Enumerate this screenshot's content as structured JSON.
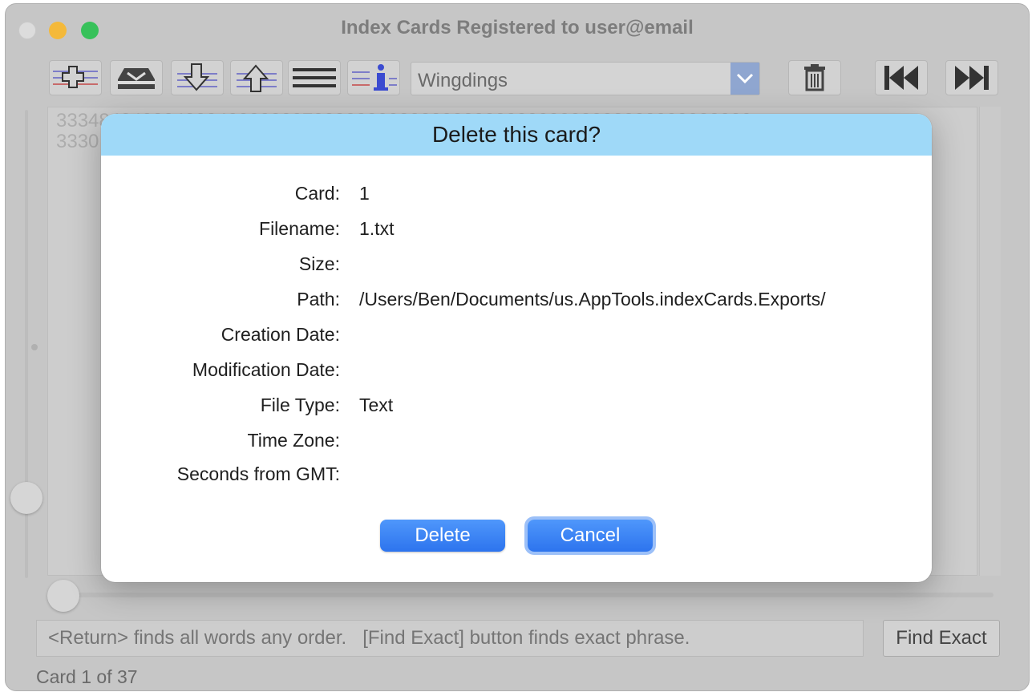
{
  "window": {
    "title": "Index Cards Registered to user@email"
  },
  "toolbar": {
    "buttons": [
      {
        "icon": "add-card-icon"
      },
      {
        "icon": "inbox-tray-icon"
      },
      {
        "icon": "import-down-icon"
      },
      {
        "icon": "export-up-icon"
      },
      {
        "icon": "lines-icon"
      },
      {
        "icon": "info-icon"
      },
      {
        "icon": "trash-icon"
      },
      {
        "icon": "first-card-icon"
      },
      {
        "icon": "last-card-icon"
      }
    ],
    "font_select_value": "Wingdings"
  },
  "card_text": {
    "line1": "33348484888488848888888788888888888888888888888888888888888888830",
    "line2": "3330"
  },
  "search": {
    "placeholder": "<Return> finds all words any order.   [Find Exact] button finds exact phrase.",
    "find_exact_label": "Find Exact"
  },
  "status": {
    "text": "Card 1 of 37"
  },
  "dialog": {
    "title": "Delete this card?",
    "rows": [
      {
        "label": "Card:",
        "value": "1"
      },
      {
        "label": "Filename:",
        "value": "1.txt"
      },
      {
        "label": "Size:",
        "value": ""
      },
      {
        "label": "Path:",
        "value": "/Users/Ben/Documents/us.AppTools.indexCards.Exports/"
      },
      {
        "label": "Creation Date:",
        "value": ""
      },
      {
        "label": "Modification Date:",
        "value": ""
      },
      {
        "label": "File Type:",
        "value": "Text"
      },
      {
        "label": "Time Zone:",
        "value": ""
      },
      {
        "label": "Seconds from GMT:",
        "value": ""
      }
    ],
    "delete_label": "Delete",
    "cancel_label": "Cancel"
  },
  "colors": {
    "dialog_header": "#9fd9f8",
    "button_blue": "#3a82f3",
    "select_arrow": "#8fa6d0"
  }
}
